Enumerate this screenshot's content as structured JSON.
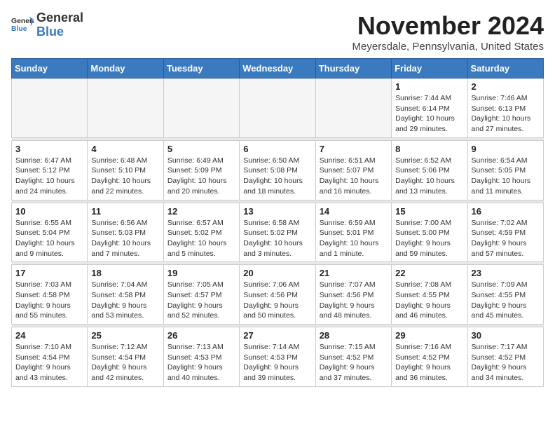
{
  "logo": {
    "general": "General",
    "blue": "Blue"
  },
  "header": {
    "month": "November 2024",
    "location": "Meyersdale, Pennsylvania, United States"
  },
  "weekdays": [
    "Sunday",
    "Monday",
    "Tuesday",
    "Wednesday",
    "Thursday",
    "Friday",
    "Saturday"
  ],
  "weeks": [
    [
      {
        "day": "",
        "info": ""
      },
      {
        "day": "",
        "info": ""
      },
      {
        "day": "",
        "info": ""
      },
      {
        "day": "",
        "info": ""
      },
      {
        "day": "",
        "info": ""
      },
      {
        "day": "1",
        "info": "Sunrise: 7:44 AM\nSunset: 6:14 PM\nDaylight: 10 hours and 29 minutes."
      },
      {
        "day": "2",
        "info": "Sunrise: 7:46 AM\nSunset: 6:13 PM\nDaylight: 10 hours and 27 minutes."
      }
    ],
    [
      {
        "day": "3",
        "info": "Sunrise: 6:47 AM\nSunset: 5:12 PM\nDaylight: 10 hours and 24 minutes."
      },
      {
        "day": "4",
        "info": "Sunrise: 6:48 AM\nSunset: 5:10 PM\nDaylight: 10 hours and 22 minutes."
      },
      {
        "day": "5",
        "info": "Sunrise: 6:49 AM\nSunset: 5:09 PM\nDaylight: 10 hours and 20 minutes."
      },
      {
        "day": "6",
        "info": "Sunrise: 6:50 AM\nSunset: 5:08 PM\nDaylight: 10 hours and 18 minutes."
      },
      {
        "day": "7",
        "info": "Sunrise: 6:51 AM\nSunset: 5:07 PM\nDaylight: 10 hours and 16 minutes."
      },
      {
        "day": "8",
        "info": "Sunrise: 6:52 AM\nSunset: 5:06 PM\nDaylight: 10 hours and 13 minutes."
      },
      {
        "day": "9",
        "info": "Sunrise: 6:54 AM\nSunset: 5:05 PM\nDaylight: 10 hours and 11 minutes."
      }
    ],
    [
      {
        "day": "10",
        "info": "Sunrise: 6:55 AM\nSunset: 5:04 PM\nDaylight: 10 hours and 9 minutes."
      },
      {
        "day": "11",
        "info": "Sunrise: 6:56 AM\nSunset: 5:03 PM\nDaylight: 10 hours and 7 minutes."
      },
      {
        "day": "12",
        "info": "Sunrise: 6:57 AM\nSunset: 5:02 PM\nDaylight: 10 hours and 5 minutes."
      },
      {
        "day": "13",
        "info": "Sunrise: 6:58 AM\nSunset: 5:02 PM\nDaylight: 10 hours and 3 minutes."
      },
      {
        "day": "14",
        "info": "Sunrise: 6:59 AM\nSunset: 5:01 PM\nDaylight: 10 hours and 1 minute."
      },
      {
        "day": "15",
        "info": "Sunrise: 7:00 AM\nSunset: 5:00 PM\nDaylight: 9 hours and 59 minutes."
      },
      {
        "day": "16",
        "info": "Sunrise: 7:02 AM\nSunset: 4:59 PM\nDaylight: 9 hours and 57 minutes."
      }
    ],
    [
      {
        "day": "17",
        "info": "Sunrise: 7:03 AM\nSunset: 4:58 PM\nDaylight: 9 hours and 55 minutes."
      },
      {
        "day": "18",
        "info": "Sunrise: 7:04 AM\nSunset: 4:58 PM\nDaylight: 9 hours and 53 minutes."
      },
      {
        "day": "19",
        "info": "Sunrise: 7:05 AM\nSunset: 4:57 PM\nDaylight: 9 hours and 52 minutes."
      },
      {
        "day": "20",
        "info": "Sunrise: 7:06 AM\nSunset: 4:56 PM\nDaylight: 9 hours and 50 minutes."
      },
      {
        "day": "21",
        "info": "Sunrise: 7:07 AM\nSunset: 4:56 PM\nDaylight: 9 hours and 48 minutes."
      },
      {
        "day": "22",
        "info": "Sunrise: 7:08 AM\nSunset: 4:55 PM\nDaylight: 9 hours and 46 minutes."
      },
      {
        "day": "23",
        "info": "Sunrise: 7:09 AM\nSunset: 4:55 PM\nDaylight: 9 hours and 45 minutes."
      }
    ],
    [
      {
        "day": "24",
        "info": "Sunrise: 7:10 AM\nSunset: 4:54 PM\nDaylight: 9 hours and 43 minutes."
      },
      {
        "day": "25",
        "info": "Sunrise: 7:12 AM\nSunset: 4:54 PM\nDaylight: 9 hours and 42 minutes."
      },
      {
        "day": "26",
        "info": "Sunrise: 7:13 AM\nSunset: 4:53 PM\nDaylight: 9 hours and 40 minutes."
      },
      {
        "day": "27",
        "info": "Sunrise: 7:14 AM\nSunset: 4:53 PM\nDaylight: 9 hours and 39 minutes."
      },
      {
        "day": "28",
        "info": "Sunrise: 7:15 AM\nSunset: 4:52 PM\nDaylight: 9 hours and 37 minutes."
      },
      {
        "day": "29",
        "info": "Sunrise: 7:16 AM\nSunset: 4:52 PM\nDaylight: 9 hours and 36 minutes."
      },
      {
        "day": "30",
        "info": "Sunrise: 7:17 AM\nSunset: 4:52 PM\nDaylight: 9 hours and 34 minutes."
      }
    ]
  ]
}
